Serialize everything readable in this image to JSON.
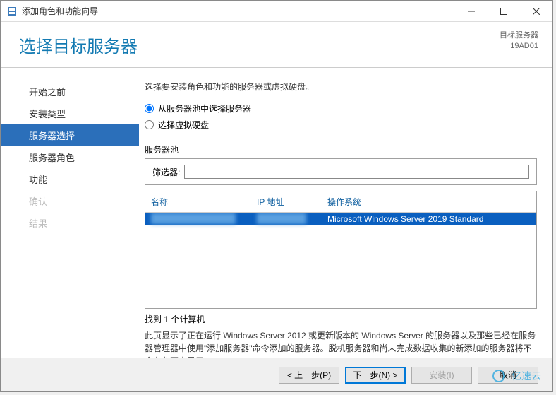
{
  "window": {
    "title": "添加角色和功能向导"
  },
  "header": {
    "title": "选择目标服务器",
    "target_label": "目标服务器",
    "target_value": "19AD01"
  },
  "sidebar": {
    "items": [
      {
        "label": "开始之前",
        "state": "normal"
      },
      {
        "label": "安装类型",
        "state": "normal"
      },
      {
        "label": "服务器选择",
        "state": "selected"
      },
      {
        "label": "服务器角色",
        "state": "normal"
      },
      {
        "label": "功能",
        "state": "normal"
      },
      {
        "label": "确认",
        "state": "disabled"
      },
      {
        "label": "结果",
        "state": "disabled"
      }
    ]
  },
  "main": {
    "instruction": "选择要安装角色和功能的服务器或虚拟硬盘。",
    "radios": {
      "pool": "从服务器池中选择服务器",
      "vhd": "选择虚拟硬盘",
      "selected": "pool"
    },
    "pool_label": "服务器池",
    "filter_label": "筛选器:",
    "filter_value": "",
    "columns": {
      "name": "名称",
      "ip": "IP 地址",
      "os": "操作系统"
    },
    "rows": [
      {
        "name": "",
        "ip": "",
        "os": "Microsoft Windows Server 2019 Standard",
        "selected": true
      }
    ],
    "count_text": "找到 1 个计算机",
    "description": "此页显示了正在运行 Windows Server 2012 或更新版本的 Windows Server 的服务器以及那些已经在服务器管理器中使用\"添加服务器\"命令添加的服务器。脱机服务器和尚未完成数据收集的新添加的服务器将不会在此页中显示。"
  },
  "footer": {
    "prev": "< 上一步(P)",
    "next": "下一步(N) >",
    "install": "安装(I)",
    "cancel": "取消"
  },
  "watermark": "亿速云"
}
